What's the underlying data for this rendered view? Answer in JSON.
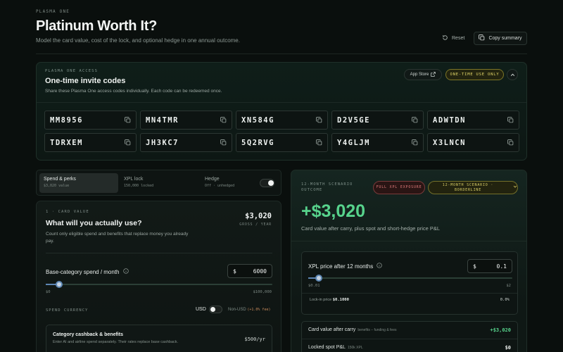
{
  "header": {
    "eyebrow": "PLASMA ONE",
    "title": "Platinum Worth It?",
    "subtitle": "Model the card value, cost of the lock, and optional hedge in one annual outcome.",
    "reset_label": "Reset",
    "copy_label": "Copy summary"
  },
  "invite": {
    "eyebrow": "PLASMA ONE ACCESS",
    "title": "One-time invite codes",
    "description": "Share these Plasma One access codes individually. Each code can be redeemed once.",
    "app_store_label": "App Store",
    "badge": "ONE-TIME USE ONLY",
    "codes": [
      "MM8956",
      "MN4TMR",
      "XN584G",
      "D2V5GE",
      "ADWTDN",
      "TDRXEM",
      "JH3KC7",
      "5Q2RVG",
      "Y4GLJM",
      "X3LNCN"
    ]
  },
  "tabs": [
    {
      "label": "Spend & perks",
      "sub": "$3,020 value"
    },
    {
      "label": "XPL lock",
      "sub": "150,000 locked"
    },
    {
      "label": "Hedge",
      "sub": "Off · unhedged"
    }
  ],
  "card_value": {
    "eyebrow": "1 · CARD VALUE",
    "title": "What will you actually use?",
    "description": "Count only eligible spend and benefits that replace money you already pay.",
    "amount": "$3,020",
    "amount_sub": "GROSS / YEAR",
    "spend_label": "Base-category spend / month",
    "spend_currency_symbol": "$",
    "spend_value": "6000",
    "spend_slider_fraction": 0.06,
    "spend_min": "$0",
    "spend_max": "$100,000",
    "currency_label": "SPEND CURRENCY",
    "currency_usd": "USD",
    "currency_non_usd": "Non-USD",
    "currency_fee": "(+1.0% fee)",
    "cashback_title": "Category cashback & benefits",
    "cashback_desc": "Enter AI and airline spend separately. Their rates replace base cashback.",
    "cashback_value": "$500/yr"
  },
  "scenario": {
    "eyebrow": "12-MONTH SCENARIO OUTCOME",
    "pill_red": "FULL XPL EXPOSURE",
    "pill_yellow": "12-MONTH SCENARIO · BORDERLINE",
    "big_value": "+$3,020",
    "description": "Card value after carry, plus spot and short-hedge price P&L",
    "xpl_label": "XPL price after 12 months",
    "xpl_symbol": "$",
    "xpl_value": "0.1",
    "xpl_slider_fraction": 0.05,
    "xpl_min": "$0.01",
    "xpl_max": "$2",
    "lockin_label": "Lock-in price",
    "lockin_price": "$0.1000",
    "lockin_change": "0.0%",
    "rows": [
      {
        "label": "Card value after carry",
        "sub": "benefits − funding & fees",
        "value": "+$3,020",
        "color": "#57d38c"
      },
      {
        "label": "Locked spot P&L",
        "sub": "150k XPL",
        "value": "$0",
        "color": "#eef2f0"
      }
    ]
  },
  "colors": {
    "accent_green": "#57d38c",
    "accent_yellow": "#d9cf66",
    "accent_red": "#e07b7b",
    "slider_blue": "#5d86b3"
  }
}
